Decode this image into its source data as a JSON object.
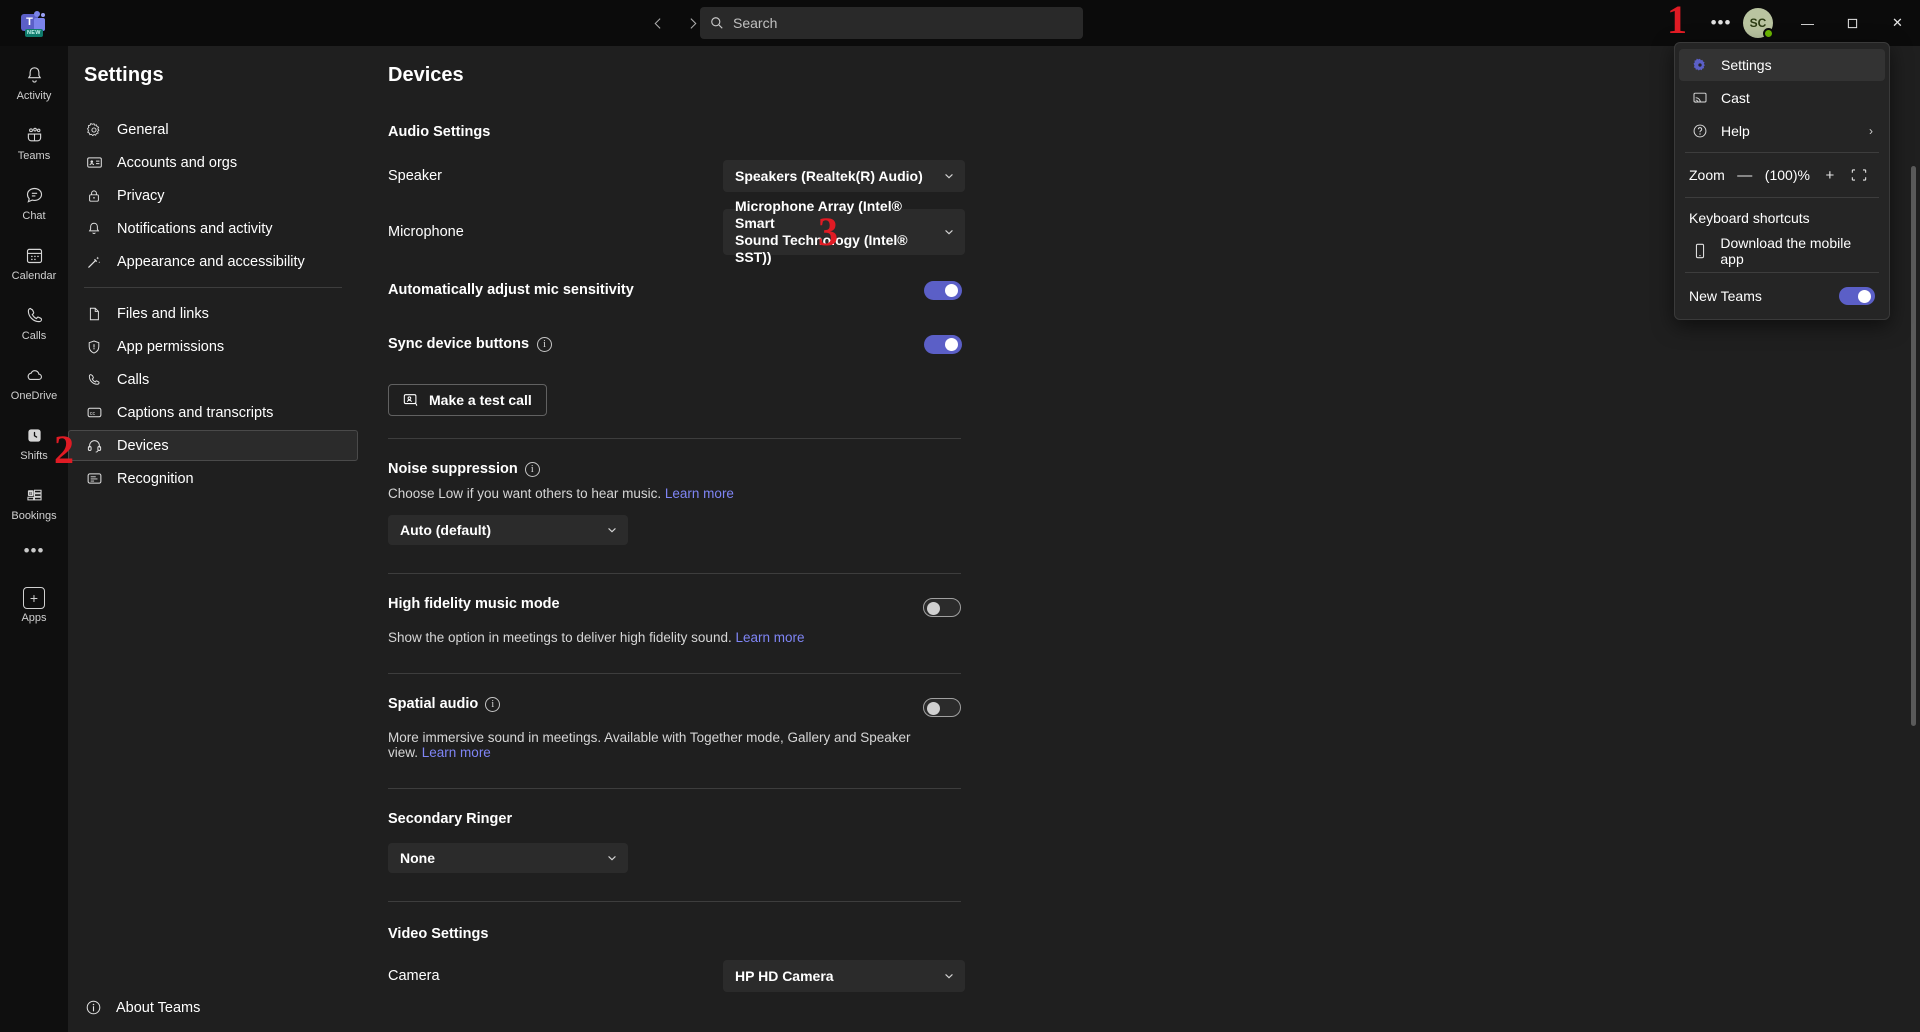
{
  "titlebar": {
    "logo_letter": "T",
    "logo_badge": "NEW",
    "back_icon": "chevron-left-icon",
    "forward_icon": "chevron-right-icon",
    "search_placeholder": "Search",
    "more_label": "•••",
    "avatar_initials": "SC",
    "minimize": "—",
    "maximize": "❐",
    "close": "✕"
  },
  "rail": {
    "items": [
      {
        "label": "Activity",
        "icon": "bell-icon"
      },
      {
        "label": "Teams",
        "icon": "teams-icon"
      },
      {
        "label": "Chat",
        "icon": "chat-icon"
      },
      {
        "label": "Calendar",
        "icon": "calendar-icon"
      },
      {
        "label": "Calls",
        "icon": "phone-icon"
      },
      {
        "label": "OneDrive",
        "icon": "cloud-icon"
      },
      {
        "label": "Shifts",
        "icon": "shifts-icon"
      },
      {
        "label": "Bookings",
        "icon": "bookings-icon"
      }
    ],
    "more_label": "•••",
    "apps_label": "Apps",
    "apps_icon": "plus-grid-icon"
  },
  "settings_nav": {
    "title": "Settings",
    "group1": [
      {
        "label": "General",
        "icon": "gear-icon"
      },
      {
        "label": "Accounts and orgs",
        "icon": "contact-card-icon"
      },
      {
        "label": "Privacy",
        "icon": "lock-icon"
      },
      {
        "label": "Notifications and activity",
        "icon": "bell-icon"
      },
      {
        "label": "Appearance and accessibility",
        "icon": "wand-icon"
      }
    ],
    "group2": [
      {
        "label": "Files and links",
        "icon": "file-icon"
      },
      {
        "label": "App permissions",
        "icon": "shield-icon"
      },
      {
        "label": "Calls",
        "icon": "phone-icon"
      },
      {
        "label": "Captions and transcripts",
        "icon": "cc-icon"
      },
      {
        "label": "Devices",
        "icon": "headset-icon",
        "selected": true
      },
      {
        "label": "Recognition",
        "icon": "recognition-icon"
      }
    ],
    "about": {
      "label": "About Teams",
      "icon": "info-icon"
    }
  },
  "main": {
    "title": "Devices",
    "audio_section_title": "Audio Settings",
    "speaker": {
      "label": "Speaker",
      "value": "Speakers (Realtek(R) Audio)"
    },
    "microphone": {
      "label": "Microphone",
      "value_line1": "Microphone Array (Intel® Smart",
      "value_line2": "Sound Technology (Intel® SST))"
    },
    "auto_mic": {
      "label": "Automatically adjust mic sensitivity",
      "state": "on"
    },
    "sync_buttons": {
      "label": "Sync device buttons",
      "state": "on",
      "info_icon": "info-icon"
    },
    "test_call": {
      "label": "Make a test call",
      "icon": "test-call-icon"
    },
    "noise_suppression": {
      "title": "Noise suppression",
      "info_icon": "info-icon",
      "desc": "Choose Low if you want others to hear music.",
      "link": "Learn more",
      "value": "Auto (default)"
    },
    "high_fidelity": {
      "title": "High fidelity music mode",
      "desc": "Show the option in meetings to deliver high fidelity sound.",
      "link": "Learn more",
      "state": "off"
    },
    "spatial_audio": {
      "title": "Spatial audio",
      "info_icon": "info-icon",
      "desc": "More immersive sound in meetings. Available with Together mode, Gallery and Speaker view.",
      "link": "Learn more",
      "state": "off"
    },
    "secondary_ringer": {
      "title": "Secondary Ringer",
      "value": "None"
    },
    "video_section_title": "Video Settings",
    "camera": {
      "label": "Camera",
      "value": "HP HD Camera"
    }
  },
  "menu": {
    "items": [
      {
        "label": "Settings",
        "icon": "gear-icon",
        "highlighted": true
      },
      {
        "label": "Cast",
        "icon": "cast-icon",
        "highlighted": false
      },
      {
        "label": "Help",
        "icon": "help-icon",
        "highlighted": false,
        "submenu": "›"
      }
    ],
    "zoom": {
      "label": "Zoom",
      "minus": "—",
      "value": "(100)%",
      "plus": "+",
      "fullscreen_icon": "fullscreen-icon"
    },
    "keyboard_shortcuts": "Keyboard shortcuts",
    "download": {
      "label": "Download the mobile app",
      "icon": "phone-mobile-icon"
    },
    "new_teams": {
      "label": "New Teams",
      "state": "on"
    }
  },
  "annotations": [
    {
      "text": "1",
      "name": "annotation-1-more-menu"
    },
    {
      "text": "2",
      "name": "annotation-2-devices"
    },
    {
      "text": "3",
      "name": "annotation-3-microphone"
    }
  ],
  "colors": {
    "accent": "#5b5fc7",
    "link": "#7f85f5",
    "annotation": "#e01b24",
    "presence_available": "#6bb700"
  }
}
